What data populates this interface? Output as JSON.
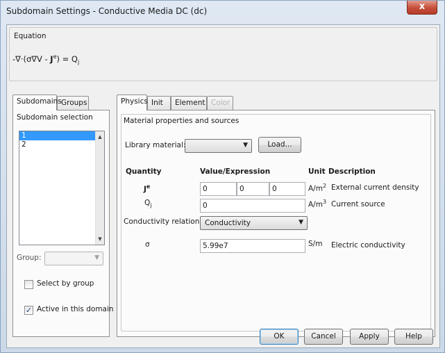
{
  "window": {
    "title": "Subdomain Settings - Conductive Media DC (dc)",
    "close_glyph": "x"
  },
  "equation": {
    "group_label": "Equation",
    "text_prefix": "-∇·(σ∇V - ",
    "J_symbol": "J",
    "J_superscript": "e",
    "text_mid": ") = Q",
    "Q_subscript": "j"
  },
  "left_panel": {
    "tabs": [
      "Subdomains",
      "Groups"
    ],
    "active_tab": "Subdomains",
    "selection_label": "Subdomain selection",
    "subdomains": [
      "1",
      "2"
    ],
    "selected_subdomain": "1",
    "group_label": "Group:",
    "group_value": "",
    "select_by_group_label": "Select by group",
    "select_by_group_checked": false,
    "active_label": "Active in this domain",
    "active_checked": true
  },
  "right_panel": {
    "tabs": [
      "Physics",
      "Init",
      "Element",
      "Color"
    ],
    "active_tab": "Physics",
    "disabled_tabs": [
      "Color"
    ],
    "section_label": "Material properties and sources",
    "library_material_label": "Library material:",
    "library_material_value": "",
    "load_button": "Load...",
    "headers": {
      "quantity": "Quantity",
      "value": "Value/Expression",
      "unit": "Unit",
      "description": "Description"
    },
    "rows": {
      "Je": {
        "symbol": "J",
        "superscript": "e",
        "values": [
          "0",
          "0",
          "0"
        ],
        "unit_base": "A/m",
        "unit_exp": "2",
        "description": "External current density"
      },
      "Qj": {
        "symbol": "Q",
        "subscript": "j",
        "value": "0",
        "unit_base": "A/m",
        "unit_exp": "3",
        "description": "Current source"
      },
      "conductivity_relation": {
        "label": "Conductivity relation:",
        "value": "Conductivity"
      },
      "sigma": {
        "symbol": "σ",
        "value": "5.99e7",
        "unit": "S/m",
        "description": "Electric conductivity"
      }
    }
  },
  "buttons": {
    "ok": "OK",
    "cancel": "Cancel",
    "apply": "Apply",
    "help": "Help"
  },
  "colors": {
    "selection": "#3399ff",
    "close_button": "#c54d3a"
  }
}
